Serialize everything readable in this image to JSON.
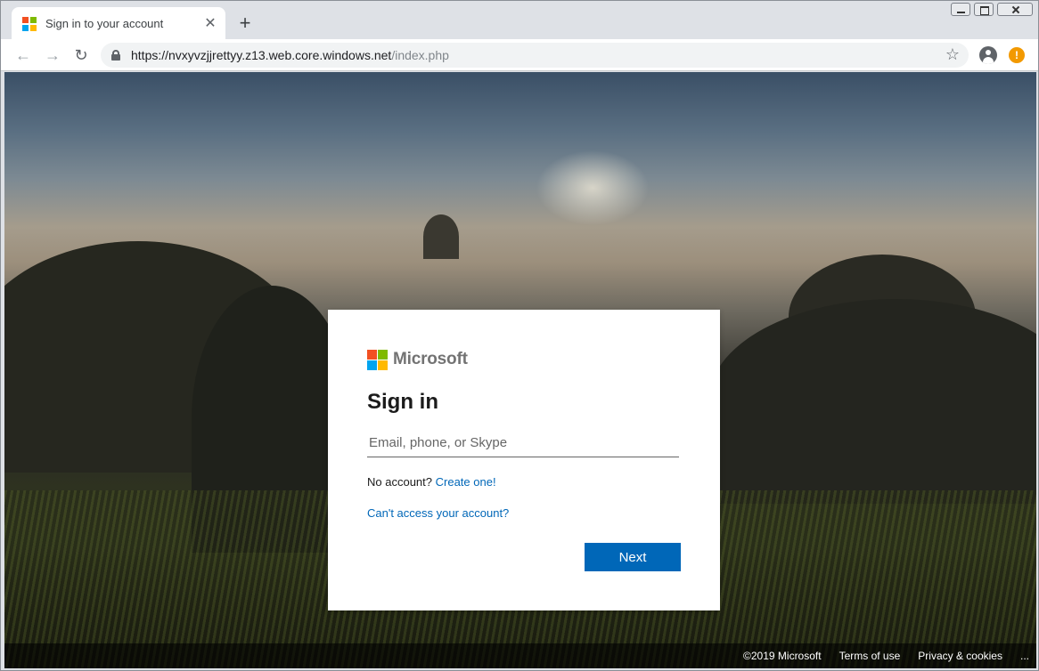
{
  "browser": {
    "tab_title": "Sign in to your account",
    "tab_close": "✕",
    "new_tab": "+",
    "url_host": "https://nvxyvzjjrettyy.z13.web.core.windows.net",
    "url_path": "/index.php",
    "back": "←",
    "forward": "→",
    "reload": "↻",
    "star": "☆",
    "alert": "!",
    "colors": {
      "alert": "#f29900"
    }
  },
  "card": {
    "brand": "Microsoft",
    "title": "Sign in",
    "email_placeholder": "Email, phone, or Skype",
    "no_account_text": "No account?",
    "create_link": "Create one!",
    "cant_access_link": "Can't access your account?",
    "next_label": "Next",
    "colors": {
      "primary": "#0067b8",
      "logo_red": "#f25022",
      "logo_green": "#7fba00",
      "logo_blue": "#00a4ef",
      "logo_yellow": "#ffb900"
    }
  },
  "footer": {
    "copyright": "©2019 Microsoft",
    "terms": "Terms of use",
    "privacy": "Privacy & cookies",
    "more": "..."
  }
}
